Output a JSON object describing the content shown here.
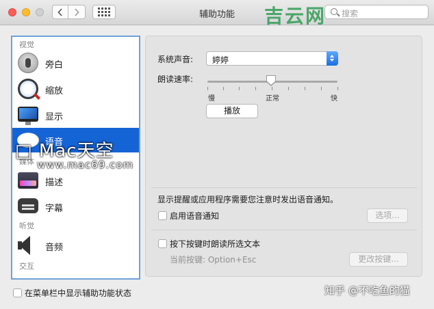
{
  "window": {
    "title": "辅助功能",
    "search_placeholder": "搜索"
  },
  "watermarks": {
    "top_right_logo": "吉云网",
    "mac_logo": "□ Mac天空",
    "mac_url": "www.mac69.com",
    "zhihu": "知乎 @不吃鱼的猫"
  },
  "sidebar": {
    "sections": [
      {
        "header": "视觉"
      },
      {
        "header": "媒体"
      },
      {
        "header": "听觉"
      },
      {
        "header": "交互"
      }
    ],
    "items": [
      {
        "label": "旁白",
        "icon": "voiceover-icon"
      },
      {
        "label": "缩放",
        "icon": "zoom-icon"
      },
      {
        "label": "显示",
        "icon": "display-icon"
      },
      {
        "label": "语音",
        "icon": "speech-icon",
        "selected": true
      },
      {
        "label": "描述",
        "icon": "descriptions-icon"
      },
      {
        "label": "字幕",
        "icon": "captions-icon"
      },
      {
        "label": "音频",
        "icon": "audio-icon"
      }
    ],
    "selection_color": "#1564d6"
  },
  "speech": {
    "system_voice_label": "系统声音:",
    "system_voice_value": "婷婷",
    "speaking_rate_label": "朗读速率:",
    "rate_slow": "慢",
    "rate_normal": "正常",
    "rate_fast": "快",
    "rate_position": 0.5,
    "play_button": "播放",
    "announce_text": "显示提醒或应用程序需要您注意时发出语音通知。",
    "enable_announcements_label": "启用语音通知",
    "enable_announcements_checked": false,
    "options_button": "选项...",
    "speak_selected_label": "按下按键时朗读所选文本",
    "speak_selected_checked": false,
    "current_key_label": "当前按键: Option+Esc",
    "change_key_button": "更改按键..."
  },
  "footer": {
    "show_in_menubar_label": "在菜单栏中显示辅助功能状态",
    "show_in_menubar_checked": false
  }
}
